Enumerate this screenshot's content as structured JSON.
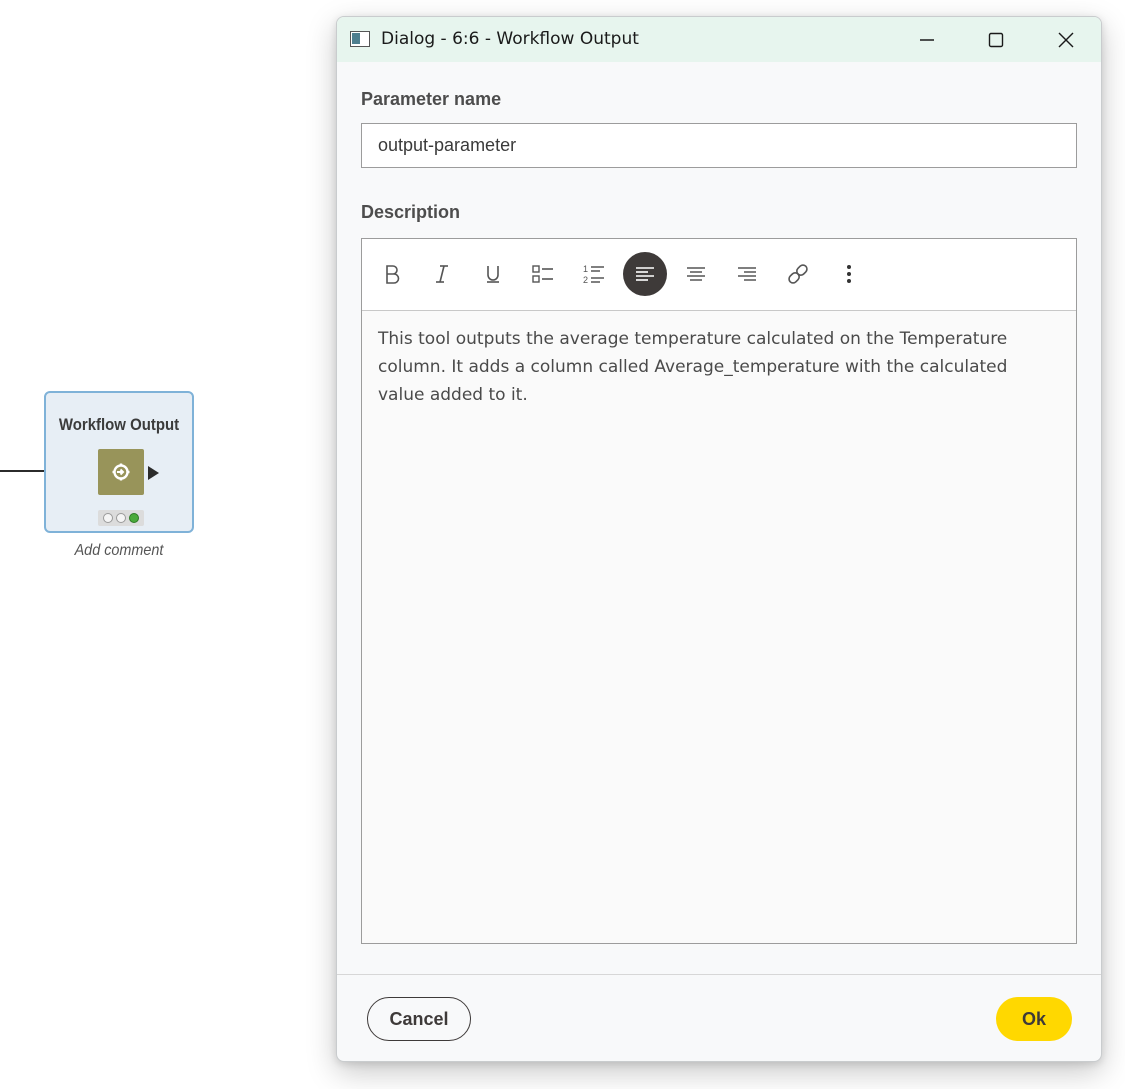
{
  "canvas": {
    "node": {
      "title": "Workflow Output",
      "comment": "Add comment",
      "status": "executed",
      "color": "#98945a"
    }
  },
  "window": {
    "title": "Dialog - 6:6 - Workflow Output",
    "controls": [
      "minimize-icon",
      "maximize-icon",
      "close-icon"
    ]
  },
  "form": {
    "parameter_name_label": "Parameter name",
    "parameter_name_value": "output-parameter",
    "description_label": "Description",
    "toolbar": [
      {
        "name": "bold",
        "icon": "bold-icon",
        "active": false
      },
      {
        "name": "italic",
        "icon": "italic-icon",
        "active": false
      },
      {
        "name": "underline",
        "icon": "underline-icon",
        "active": false
      },
      {
        "name": "bullet-list",
        "icon": "bullet-list-icon",
        "active": false
      },
      {
        "name": "numbered-list",
        "icon": "numbered-list-icon",
        "active": false
      },
      {
        "name": "align-left",
        "icon": "align-left-icon",
        "active": true
      },
      {
        "name": "align-center",
        "icon": "align-center-icon",
        "active": false
      },
      {
        "name": "align-right",
        "icon": "align-right-icon",
        "active": false
      },
      {
        "name": "link",
        "icon": "link-icon",
        "active": false
      },
      {
        "name": "more",
        "icon": "more-vertical-icon",
        "active": false
      }
    ],
    "description_text": "This tool outputs the average temperature calculated on the Temperature column. It adds a column called Average_temperature with the calculated value added to it."
  },
  "footer": {
    "cancel_label": "Cancel",
    "ok_label": "Ok"
  },
  "colors": {
    "titlebar": "#e7f5ee",
    "ok_button": "#ffd800",
    "active_tool": "#3e3a39"
  }
}
